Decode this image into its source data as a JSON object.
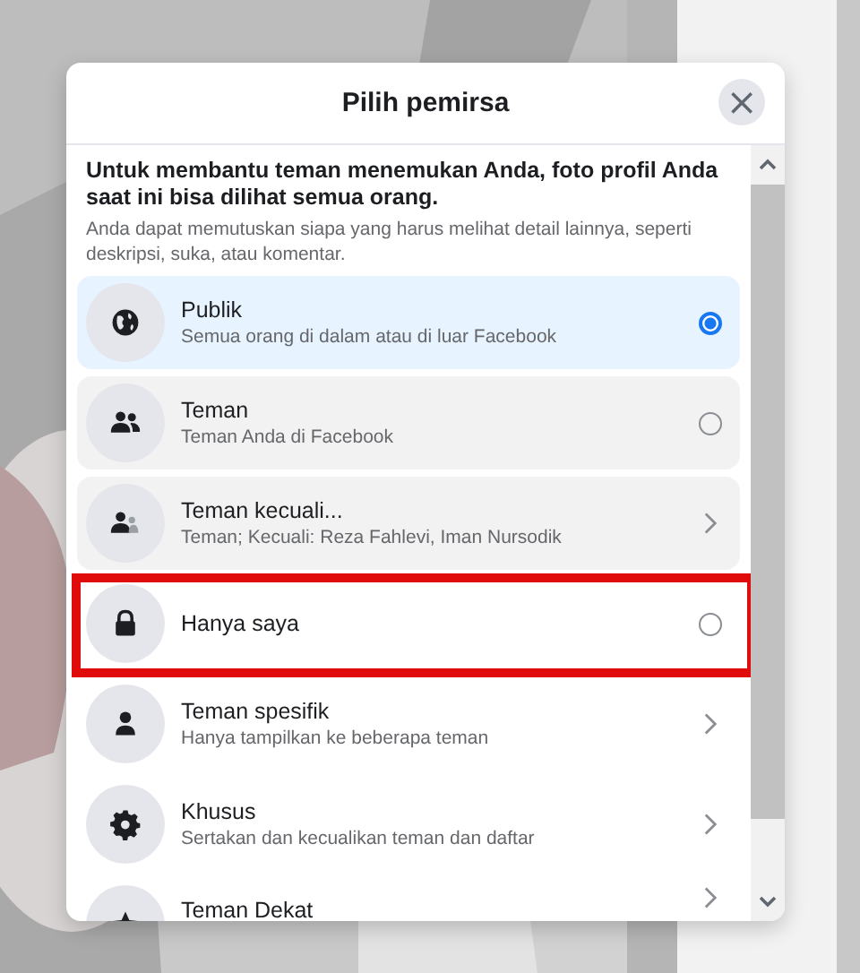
{
  "dialog": {
    "title": "Pilih pemirsa",
    "close_label": "×"
  },
  "intro": {
    "heading": "Untuk membantu teman menemukan Anda, foto profil Anda saat ini bisa dilihat semua orang.",
    "text": "Anda dapat memutuskan siapa yang harus melihat detail lainnya, seperti deskripsi, suka, atau komentar."
  },
  "options": [
    {
      "kind": "radio",
      "label": "Publik",
      "description": "Semua orang di dalam atau di luar Facebook",
      "selected": true,
      "hovered": false,
      "outlined": false
    },
    {
      "kind": "radio",
      "label": "Teman",
      "description": "Teman Anda di Facebook",
      "selected": false,
      "hovered": true,
      "outlined": false
    },
    {
      "kind": "submenu",
      "label": "Teman kecuali...",
      "description": "Teman; Kecuali: Reza Fahlevi, Iman Nursodik",
      "selected": false,
      "hovered": true,
      "outlined": false
    },
    {
      "kind": "radio",
      "label": "Hanya saya",
      "selected": false,
      "hovered": false,
      "outlined": true
    },
    {
      "kind": "submenu",
      "label": "Teman spesifik",
      "description": "Hanya tampilkan ke beberapa teman",
      "selected": false,
      "hovered": false,
      "outlined": false
    },
    {
      "kind": "submenu",
      "label": "Khusus",
      "description": "Sertakan dan kecualikan teman dan daftar",
      "selected": false,
      "hovered": false,
      "outlined": false
    },
    {
      "kind": "submenu",
      "label": "Teman Dekat",
      "selected": false,
      "hovered": false,
      "outlined": false
    }
  ]
}
